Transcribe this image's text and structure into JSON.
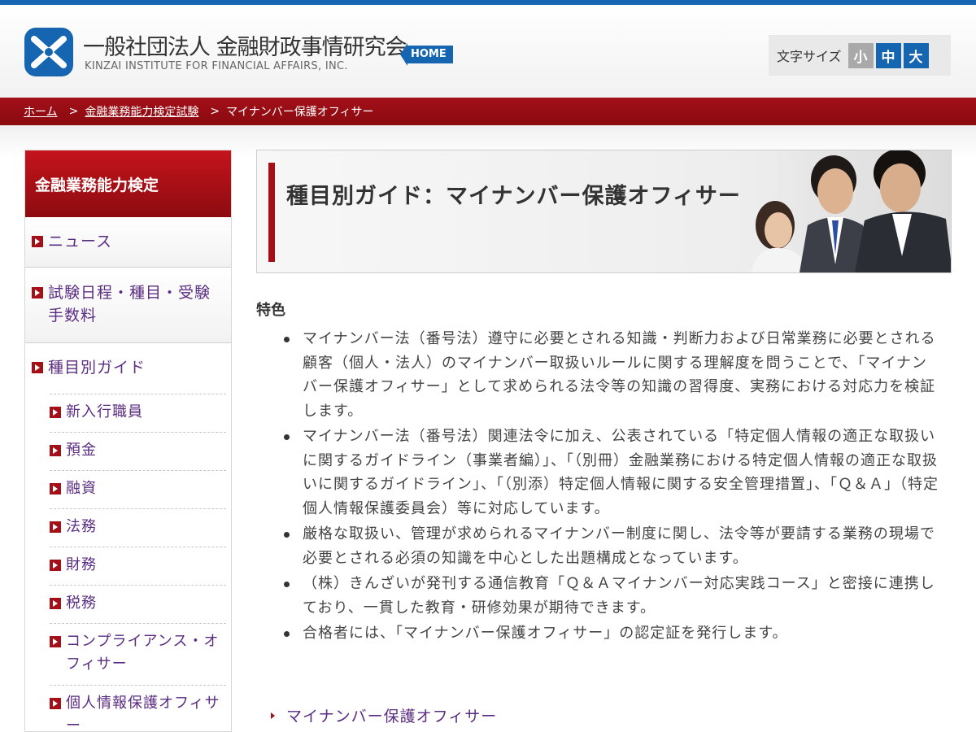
{
  "header": {
    "org_name_jp": "一般社団法人 金融財政事情研究会",
    "org_name_en": "KINZAI INSTITUTE FOR FINANCIAL AFFAIRS, INC.",
    "home_label": "HOME",
    "font_size_label": "文字サイズ",
    "font_size_options": [
      "小",
      "中",
      "大"
    ]
  },
  "breadcrumb": {
    "items": [
      "ホーム",
      "金融業務能力検定試験"
    ],
    "current": "マイナンバー保護オフィサー",
    "separator": ">"
  },
  "sidebar": {
    "heading": "金融業務能力検定",
    "items": [
      {
        "label": "ニュース"
      },
      {
        "label": "試験日程・種目・受験手数料"
      },
      {
        "label": "種目別ガイド"
      }
    ],
    "sub_items": [
      {
        "label": "新入行職員"
      },
      {
        "label": "預金"
      },
      {
        "label": "融資"
      },
      {
        "label": "法務"
      },
      {
        "label": "財務"
      },
      {
        "label": "税務"
      },
      {
        "label": "コンプライアンス・オフィサー"
      },
      {
        "label": "個人情報保護オフィサー"
      }
    ]
  },
  "main": {
    "title": "種目別ガイド：マイナンバー保護オフィサー",
    "section_heading": "特色",
    "features": [
      "マイナンバー法（番号法）遵守に必要とされる知識・判断力および日常業務に必要とされる顧客（個人・法人）のマイナンバー取扱いルールに関する理解度を問うことで、「マイナンバー保護オフィサー」として求められる法令等の知識の習得度、実務における対応力を検証します。",
      "マイナンバー法（番号法）関連法令に加え、公表されている「特定個人情報の適正な取扱いに関するガイドライン（事業者編）」、「（別冊）金融業務における特定個人情報の適正な取扱いに関するガイドライン」、「（別添）特定個人情報に関する安全管理措置」、「Ｑ＆Ａ」（特定個人情報保護委員会）等に対応しています。",
      "厳格な取扱い、管理が求められるマイナンバー制度に関し、法令等が要請する業務の現場で必要とされる必須の知識を中心とした出題構成となっています。",
      "（株）きんざいが発刊する通信教育「Ｑ＆Ａマイナンバー対応実践コース」と密接に連携しており、一貫した教育・研修効果が期待できます。",
      "合格者には、「マイナンバー保護オフィサー」の認定証を発行します。"
    ],
    "link_label": "マイナンバー保護オフィサー"
  },
  "colors": {
    "brand_blue": "#1565b0",
    "brand_red": "#a50f17",
    "link_purple": "#5a2c82"
  }
}
